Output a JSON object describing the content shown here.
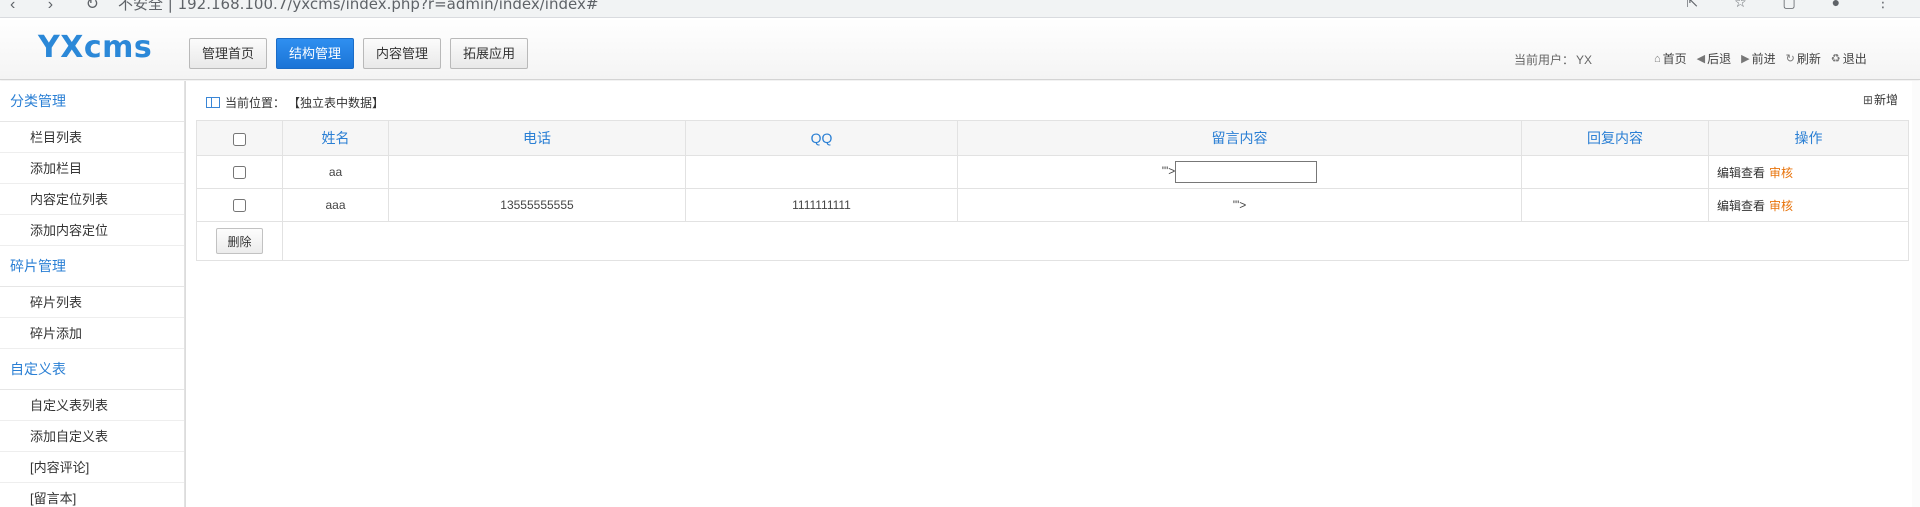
{
  "browser": {
    "url_text": "不安全 | 192.168.100.7/yxcms/index.php?r=admin/index/index#",
    "nav_glyphs": "‹ › ↻",
    "right_glyphs": "⇱ ☆ ▢ ● ⋮"
  },
  "header": {
    "logo": "YXcms",
    "tabs": [
      {
        "label": "管理首页",
        "active": false
      },
      {
        "label": "结构管理",
        "active": true
      },
      {
        "label": "内容管理",
        "active": false
      },
      {
        "label": "拓展应用",
        "active": false
      }
    ],
    "current_user_label": "当前用户：",
    "current_user": "YX",
    "quick_links": [
      {
        "icon": "home-icon",
        "glyph": "⌂",
        "label": "首页"
      },
      {
        "icon": "back-icon",
        "glyph": "◀",
        "label": "后退"
      },
      {
        "icon": "forward-icon",
        "glyph": "▶",
        "label": "前进"
      },
      {
        "icon": "refresh-icon",
        "glyph": "↻",
        "label": "刷新"
      },
      {
        "icon": "logout-icon",
        "glyph": "♻",
        "label": "退出"
      }
    ]
  },
  "sidebar": {
    "groups": [
      {
        "title": "分类管理",
        "items": [
          "栏目列表",
          "添加栏目",
          "内容定位列表",
          "添加内容定位"
        ]
      },
      {
        "title": "碎片管理",
        "items": [
          "碎片列表",
          "碎片添加"
        ]
      },
      {
        "title": "自定义表",
        "items": [
          "自定义表列表",
          "添加自定义表",
          "[内容评论]",
          "[留言本]"
        ]
      }
    ]
  },
  "main": {
    "breadcrumb_label": "当前位置：",
    "breadcrumb_value": "【独立表中数据】",
    "add_new_label": "新增",
    "table": {
      "headers": [
        "姓名",
        "电话",
        "QQ",
        "留言内容",
        "回复内容",
        "操作"
      ],
      "rows": [
        {
          "name": "aa",
          "phone": "",
          "qq": "",
          "message_prefix": "'\">",
          "has_input": true,
          "reply": "",
          "edit_label": "编辑查看",
          "audit_label": "审核"
        },
        {
          "name": "aaa",
          "phone": "13555555555",
          "qq": "1111111111",
          "message_prefix": "'\">",
          "has_input": false,
          "reply": "",
          "edit_label": "编辑查看",
          "audit_label": "审核"
        }
      ],
      "delete_label": "删除"
    }
  },
  "colors": {
    "accent": "#2a7fd4",
    "active_tab": "#1b74d6",
    "audit": "#e8740c"
  }
}
